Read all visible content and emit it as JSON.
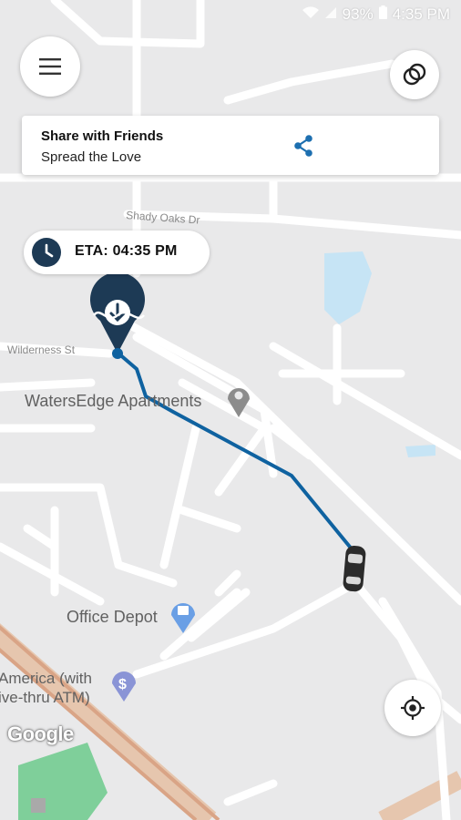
{
  "status_bar": {
    "battery": "93%",
    "time": "4:35 PM"
  },
  "share_card": {
    "title": "Share with Friends",
    "subtitle": "Spread the Love"
  },
  "eta": {
    "label": "ETA: 04:35 PM"
  },
  "map": {
    "labels": {
      "apartments": "WatersEdge Apartments",
      "office_depot": "Office Depot",
      "bank_line1": "America (with",
      "bank_line2": "ive-thru ATM)",
      "shady_oaks": "Shady Oaks Dr",
      "wilderness": "Wilderness St",
      "attribution": "Google"
    },
    "route_color": "#0f62a0",
    "pin_color": "#1d3a55",
    "park_color": "#7fcf9a",
    "water_color": "#c6e4f5"
  },
  "icons": {
    "menu": "hamburger-menu-icon",
    "layers": "layers-icon",
    "share": "share-icon",
    "clock": "clock-icon",
    "locate": "my-location-icon",
    "car": "car-icon",
    "destination": "destination-pin-icon"
  }
}
